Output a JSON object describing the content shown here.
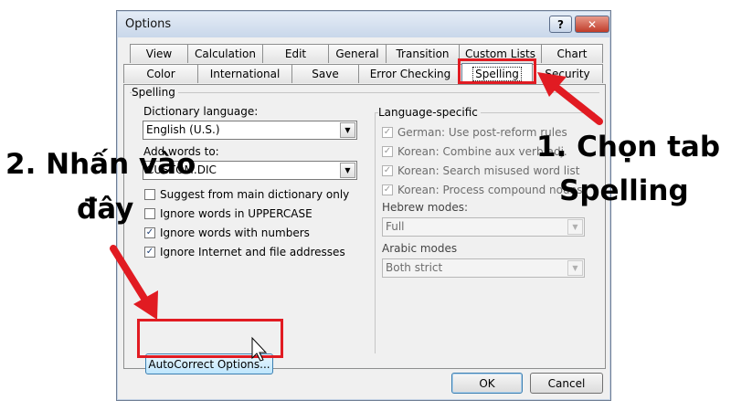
{
  "window": {
    "title": "Options",
    "help_glyph": "?",
    "close_glyph": "✕"
  },
  "tabs": {
    "row1": [
      "View",
      "Calculation",
      "Edit",
      "General",
      "Transition",
      "Custom Lists",
      "Chart"
    ],
    "row2": [
      "Color",
      "International",
      "Save",
      "Error Checking",
      "Spelling",
      "Security"
    ],
    "active": "Spelling"
  },
  "spelling": {
    "group_title": "Spelling",
    "dictionary_label": "Dictionary language:",
    "dictionary_value": "English (U.S.)",
    "add_words_label": "Add words to:",
    "add_words_value": "CUSTOM.DIC",
    "checkboxes": [
      {
        "label": "Suggest from main dictionary only",
        "checked": false
      },
      {
        "label": "Ignore words in UPPERCASE",
        "checked": false
      },
      {
        "label": "Ignore words with numbers",
        "checked": true
      },
      {
        "label": "Ignore Internet and file addresses",
        "checked": true
      }
    ],
    "autocorrect_button": "AutoCorrect Options..."
  },
  "language_specific": {
    "group_title": "Language-specific",
    "checkboxes": [
      {
        "label": "German: Use post-reform rules",
        "checked": true
      },
      {
        "label": "Korean: Combine aux verb/adj.",
        "checked": true
      },
      {
        "label": "Korean: Search misused word list",
        "checked": true
      },
      {
        "label": "Korean: Process compound nouns",
        "checked": true
      }
    ],
    "hebrew_label": "Hebrew modes:",
    "hebrew_value": "Full",
    "arabic_label": "Arabic modes",
    "arabic_value": "Both strict"
  },
  "footer": {
    "ok": "OK",
    "cancel": "Cancel"
  },
  "annotations": {
    "step1_line1": "1. Chọn tab",
    "step1_line2": "Spelling",
    "step2_line1": "2. Nhấn vào",
    "step2_line2": "đây",
    "highlight_color": "#e11b22"
  }
}
